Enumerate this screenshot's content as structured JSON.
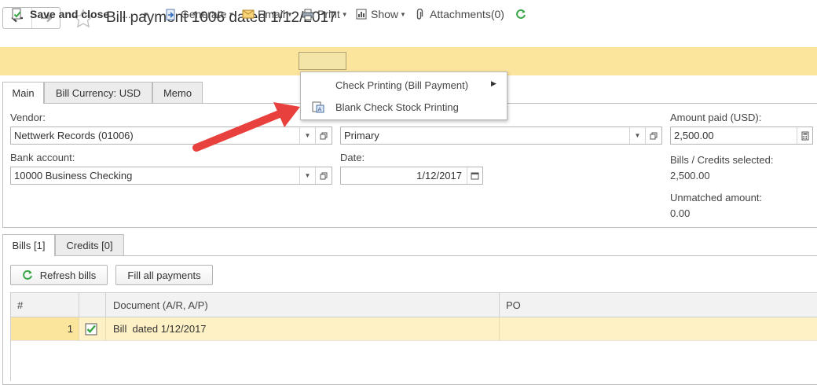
{
  "window": {
    "title": "Bill payment 1006 dated 1/12/2017"
  },
  "toolbar": {
    "save_close": "Save and close",
    "more": "...",
    "generate": "Generate",
    "email": "Email",
    "print": "Print",
    "show": "Show",
    "attachments": "Attachments(0)"
  },
  "print_menu": {
    "items": [
      {
        "label": "Check Printing (Bill Payment)",
        "has_submenu": true
      },
      {
        "label": "Blank Check Stock Printing",
        "icon": "check-document-icon"
      }
    ]
  },
  "tabs": {
    "top": [
      "Main",
      "Bill Currency: USD",
      "Memo"
    ],
    "bottom": [
      "Bills [1]",
      "Credits [0]"
    ]
  },
  "form": {
    "vendor_label": "Vendor:",
    "vendor_value": "Nettwerk Records (01006)",
    "remit_to_value": "Primary",
    "bank_label": "Bank account:",
    "bank_value": "10000 Business Checking",
    "date_label": "Date:",
    "date_value": "1/12/2017",
    "amount_label": "Amount paid (USD):",
    "amount_value": "2,500.00",
    "selected_label": "Bills / Credits selected:",
    "selected_value": "2,500.00",
    "unmatched_label": "Unmatched amount:",
    "unmatched_value": "0.00"
  },
  "actions": {
    "refresh": "Refresh bills",
    "fill_all": "Fill all payments"
  },
  "table": {
    "columns": [
      "#",
      "",
      "Document (A/R, A/P)",
      "PO"
    ],
    "rows": [
      {
        "num": "1",
        "checked": true,
        "document": "Bill  dated 1/12/2017",
        "po": ""
      }
    ]
  },
  "colors": {
    "toolbar_bg": "#fbe49c",
    "row_highlight": "#fdf1c5",
    "accent_green": "#3aa648",
    "arrow_red": "#e8403d"
  }
}
